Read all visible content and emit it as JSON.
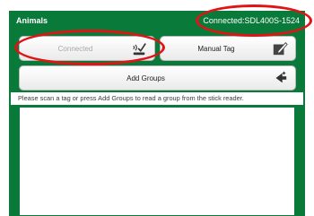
{
  "header": {
    "title": "Animals",
    "connection_status": "Connected:SDL400S-1524"
  },
  "buttons": {
    "connected_label": "Connected",
    "manual_tag_label": "Manual Tag",
    "add_groups_label": "Add Groups"
  },
  "icons": {
    "connected": "connected-check-icon",
    "manual_tag": "edit-tag-icon",
    "add_groups": "add-groups-icon"
  },
  "hint": "Please scan a tag or press Add Groups to read a group from the stick reader.",
  "colors": {
    "brand_green": "#0a7a3a",
    "annotation_red": "#e01414"
  }
}
